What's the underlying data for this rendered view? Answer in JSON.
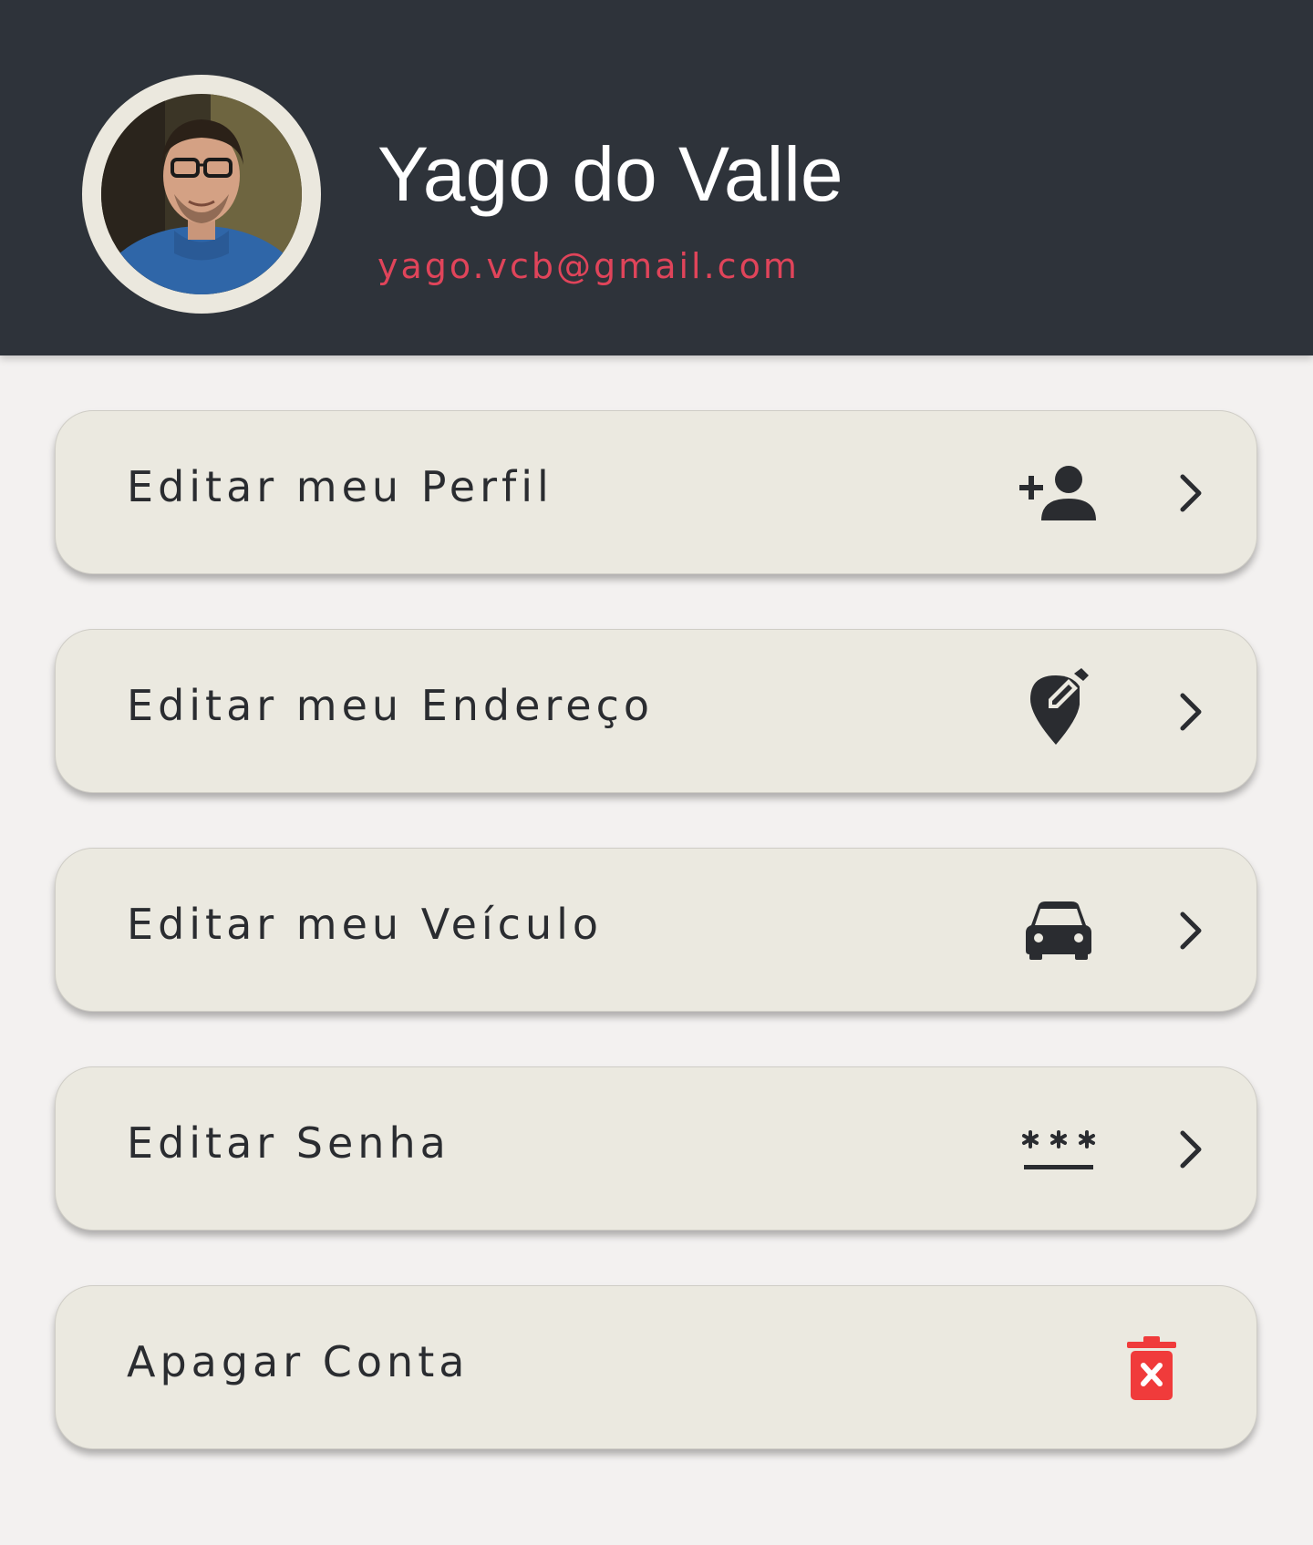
{
  "profile": {
    "name": "Yago do Valle",
    "email": "yago.vcb@gmail.com"
  },
  "colors": {
    "header_bg": "#2e333a",
    "email": "#e0445a",
    "card_bg": "#ebe9e0",
    "danger": "#f03b3b"
  },
  "menu": {
    "items": [
      {
        "label": "Editar meu Perfil",
        "icon": "person-add-icon"
      },
      {
        "label": "Editar meu Endereço",
        "icon": "edit-location-icon"
      },
      {
        "label": "Editar meu Veículo",
        "icon": "car-icon"
      },
      {
        "label": "Editar Senha",
        "icon": "password-icon"
      },
      {
        "label": "Apagar Conta",
        "icon": "delete-forever-icon"
      }
    ]
  }
}
